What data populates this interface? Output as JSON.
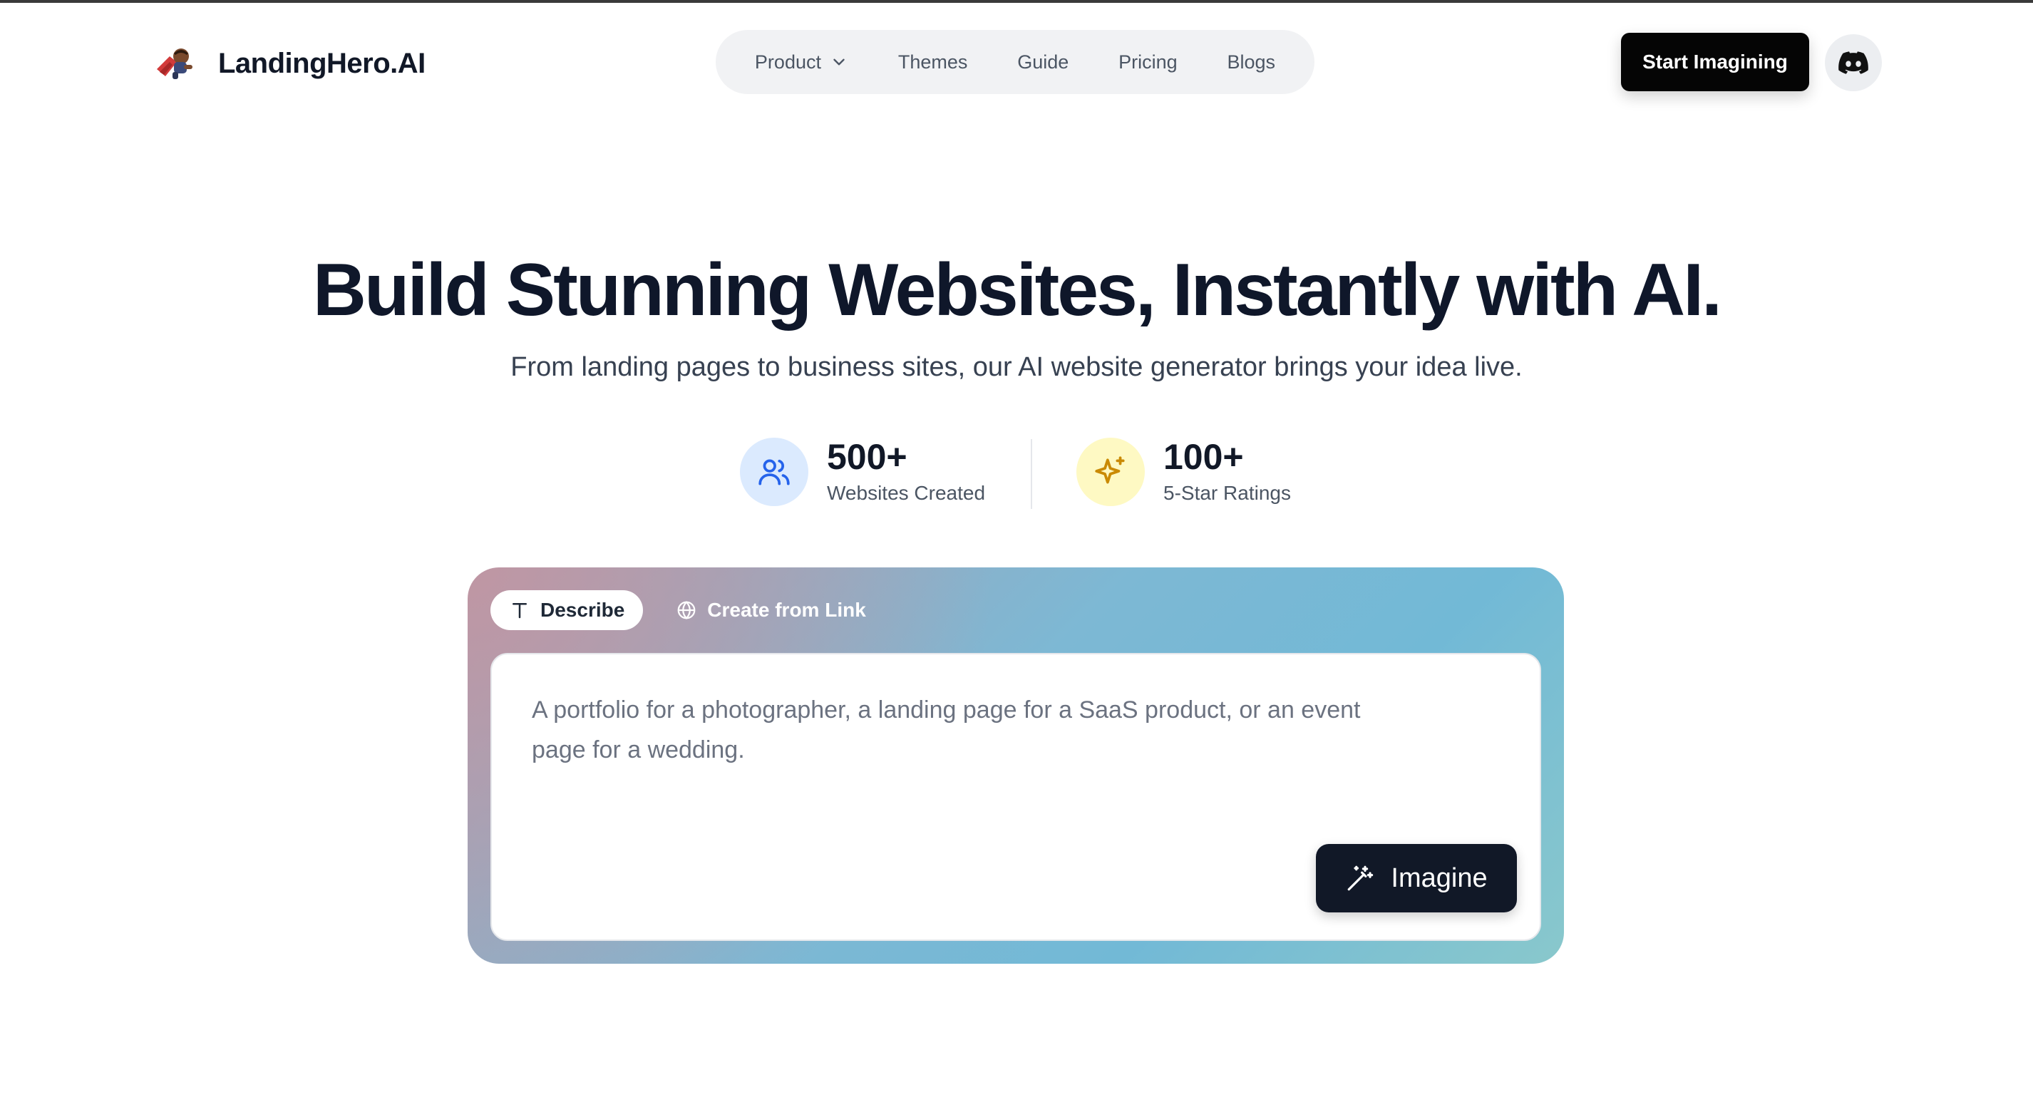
{
  "brand": {
    "name": "LandingHero.AI",
    "logo_icon": "superhero-mascot-icon"
  },
  "nav": {
    "items": [
      {
        "label": "Product",
        "has_dropdown": true
      },
      {
        "label": "Themes"
      },
      {
        "label": "Guide"
      },
      {
        "label": "Pricing"
      },
      {
        "label": "Blogs"
      }
    ]
  },
  "header": {
    "cta_label": "Start Imagining",
    "discord_icon": "discord-icon"
  },
  "hero": {
    "title": "Build Stunning Websites, Instantly with AI.",
    "subtitle": "From landing pages to business sites, our AI website generator brings your idea live."
  },
  "stats": [
    {
      "number": "500+",
      "label": "Websites Created",
      "icon": "users-icon",
      "icon_bg": "#dbeafe",
      "icon_color": "#2563eb"
    },
    {
      "number": "100+",
      "label": "5-Star Ratings",
      "icon": "sparkle-icon",
      "icon_bg": "#fef9c3",
      "icon_color": "#ca8a04"
    }
  ],
  "prompt": {
    "tabs": [
      {
        "label": "Describe",
        "icon": "text-icon",
        "active": true
      },
      {
        "label": "Create from Link",
        "icon": "globe-icon",
        "active": false
      }
    ],
    "placeholder": "A portfolio for a photographer, a landing page for a SaaS product, or an event page for a wedding.",
    "value": "",
    "submit_label": "Imagine",
    "submit_icon": "magic-wand-icon"
  },
  "colors": {
    "primary_dark": "#111827",
    "cta_black": "#050505",
    "nav_bg": "#f1f2f4",
    "card_gradient_start": "#c494a0",
    "card_gradient_end": "#72b9d6"
  }
}
